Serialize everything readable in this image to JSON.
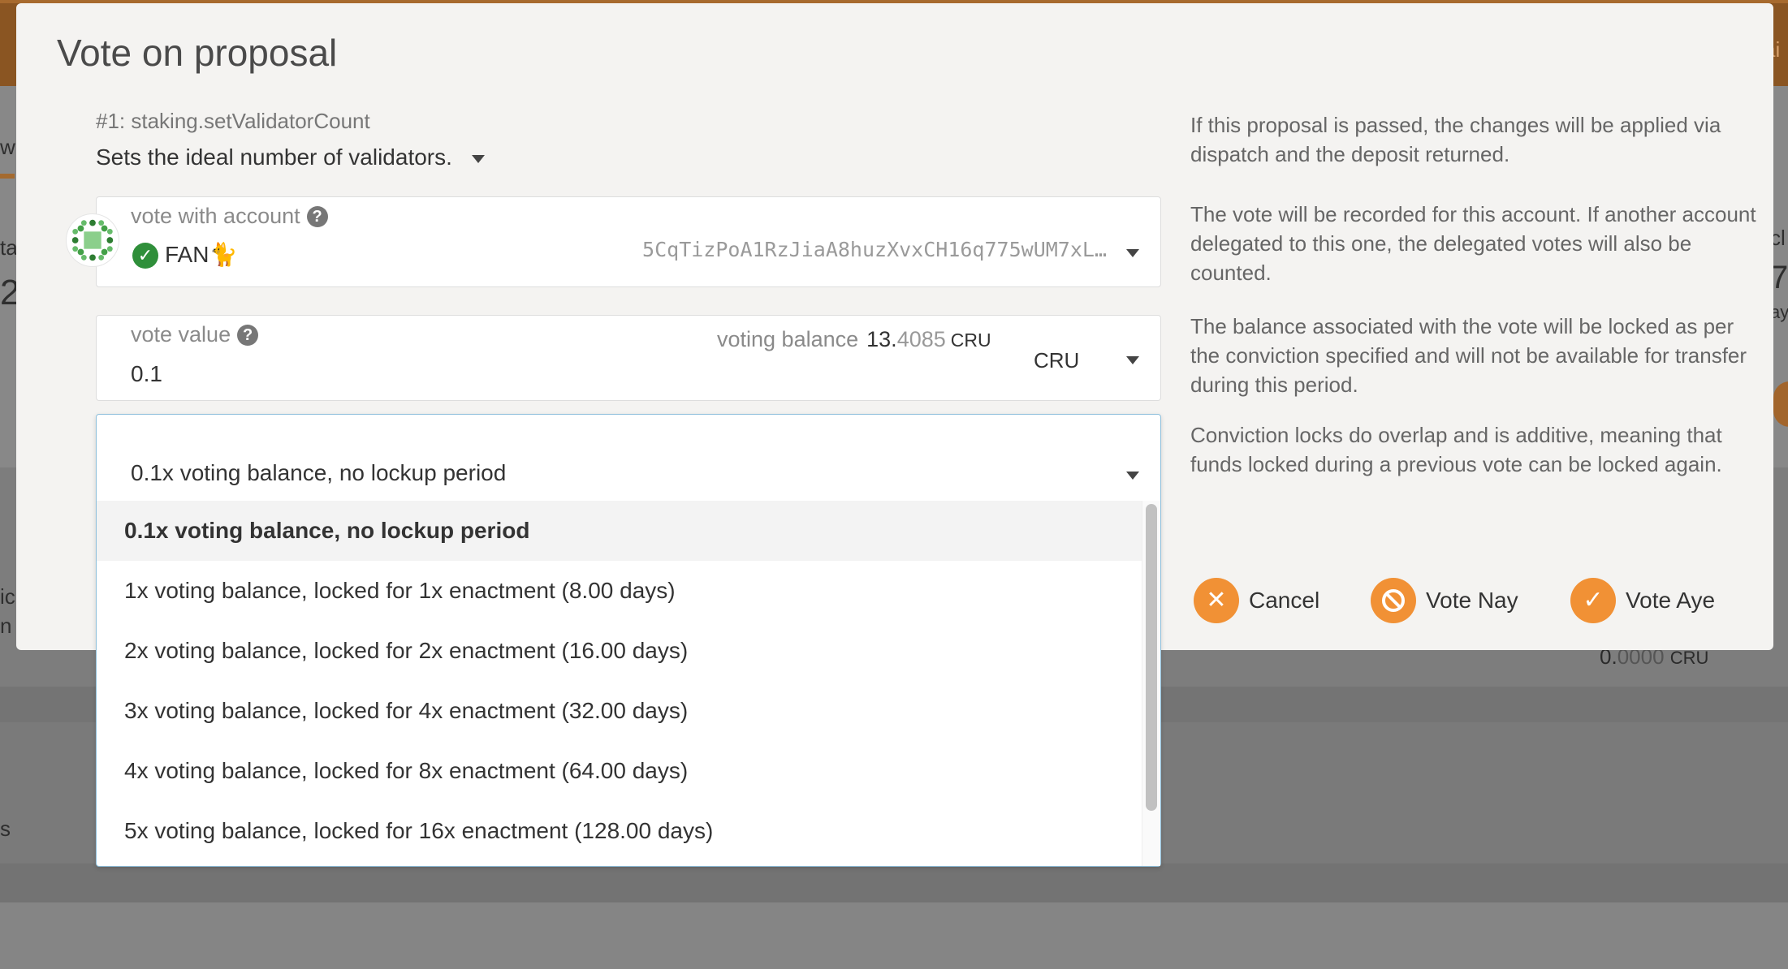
{
  "backdrop": {
    "fragments": {
      "left_w": "w",
      "left_ta": "ta",
      "left_2": "2",
      "left_ic": "ic",
      "left_n": "n",
      "left_s": "s",
      "right_ai": "ai",
      "right_cl": "cl",
      "right_7": "7",
      "right_ay": "ay"
    },
    "balance": {
      "whole": "0.",
      "decimals": "0000",
      "unit": "CRU"
    }
  },
  "modal": {
    "title": "Vote on proposal",
    "proposal": {
      "id": "#1: staking.setValidatorCount",
      "description": "Sets the ideal number of validators."
    },
    "account": {
      "label": "vote with account",
      "name": "FAN🐈",
      "address": "5CqTizPoA1RzJiaA8huzXvxCH16q775wUM7xL…"
    },
    "vote_value": {
      "label": "vote value",
      "value": "0.1",
      "balance_label": "voting balance",
      "balance_whole": "13.",
      "balance_decimals": "4085",
      "balance_unit": "CRU",
      "unit_select": "CRU"
    },
    "conviction": {
      "selected": "0.1x voting balance, no lockup period",
      "options": [
        "0.1x voting balance, no lockup period",
        "1x voting balance, locked for 1x enactment (8.00 days)",
        "2x voting balance, locked for 2x enactment (16.00 days)",
        "3x voting balance, locked for 4x enactment (32.00 days)",
        "4x voting balance, locked for 8x enactment (64.00 days)",
        "5x voting balance, locked for 16x enactment (128.00 days)"
      ],
      "active_index": 0
    },
    "help": [
      "If this proposal is passed, the changes will be applied via dispatch and the deposit returned.",
      "The vote will be recorded for this account. If another account delegated to this one, the delegated votes will also be counted.",
      "The balance associated with the vote will be locked as per the conviction specified and will not be available for transfer during this period.",
      "Conviction locks do overlap and is additive, meaning that funds locked during a previous vote can be locked again."
    ],
    "buttons": {
      "cancel": "Cancel",
      "nay": "Vote Nay",
      "aye": "Vote Aye"
    },
    "icons": {
      "cancel": "close-icon",
      "nay": "ban-icon",
      "aye": "check-icon",
      "accent_color": "#f19135"
    }
  }
}
